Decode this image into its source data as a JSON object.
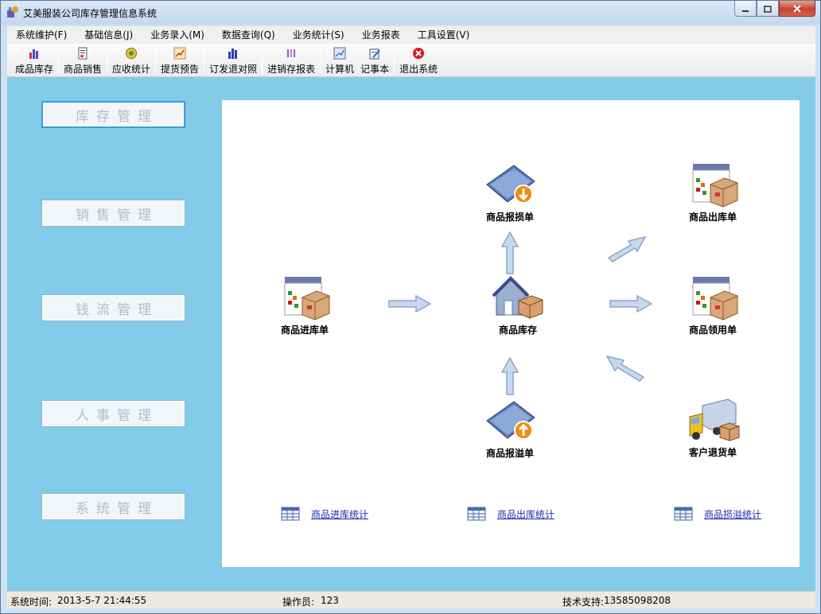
{
  "window": {
    "title": "艾美服装公司库存管理信息系统"
  },
  "menu": [
    "系统维护(F)",
    "基础信息(J)",
    "业务录入(M)",
    "数据查询(Q)",
    "业务统计(S)",
    "业务报表",
    "工具设置(V)"
  ],
  "toolbar": [
    {
      "label": "成品库存",
      "icon": "bar-chart-icon"
    },
    {
      "label": "商品销售",
      "icon": "document-icon"
    },
    {
      "label": "应收统计",
      "icon": "coin-icon"
    },
    {
      "label": "提货预告",
      "icon": "trend-chart-icon"
    },
    {
      "label": "订发退对照",
      "icon": "bar-chart-icon"
    },
    {
      "label": "进销存报表",
      "icon": "report-icon"
    },
    {
      "label": "计算机",
      "icon": "calculator-icon"
    },
    {
      "label": "记事本",
      "icon": "notepad-icon"
    },
    {
      "label": "退出系统",
      "icon": "exit-icon"
    }
  ],
  "nav": [
    {
      "label": "库存管理",
      "active": true
    },
    {
      "label": "销售管理",
      "active": false
    },
    {
      "label": "钱流管理",
      "active": false
    },
    {
      "label": "人事管理",
      "active": false
    },
    {
      "label": "系统管理",
      "active": false
    }
  ],
  "flow": {
    "inbound": "商品进库单",
    "stock": "商品库存",
    "loss": "商品报损单",
    "overflow": "商品报溢单",
    "outbound": "商品出库单",
    "requisition": "商品领用单",
    "return": "客户退货单"
  },
  "stats": [
    "商品进库统计",
    "商品出库统计",
    "商品损溢统计"
  ],
  "status": {
    "time_label": "系统时间:",
    "time_value": "2013-5-7  21:44:55",
    "operator_label": "操作员:",
    "operator_value": "123",
    "support_label": "技术支持:",
    "support_value": "13585098208"
  }
}
